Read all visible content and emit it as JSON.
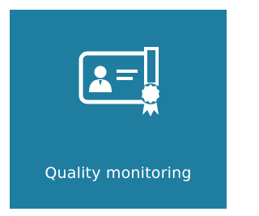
{
  "tile": {
    "label": "Quality monitoring",
    "icon": "certificate-icon",
    "background_color": "#1F7DA0",
    "foreground_color": "#FFFFFF"
  }
}
